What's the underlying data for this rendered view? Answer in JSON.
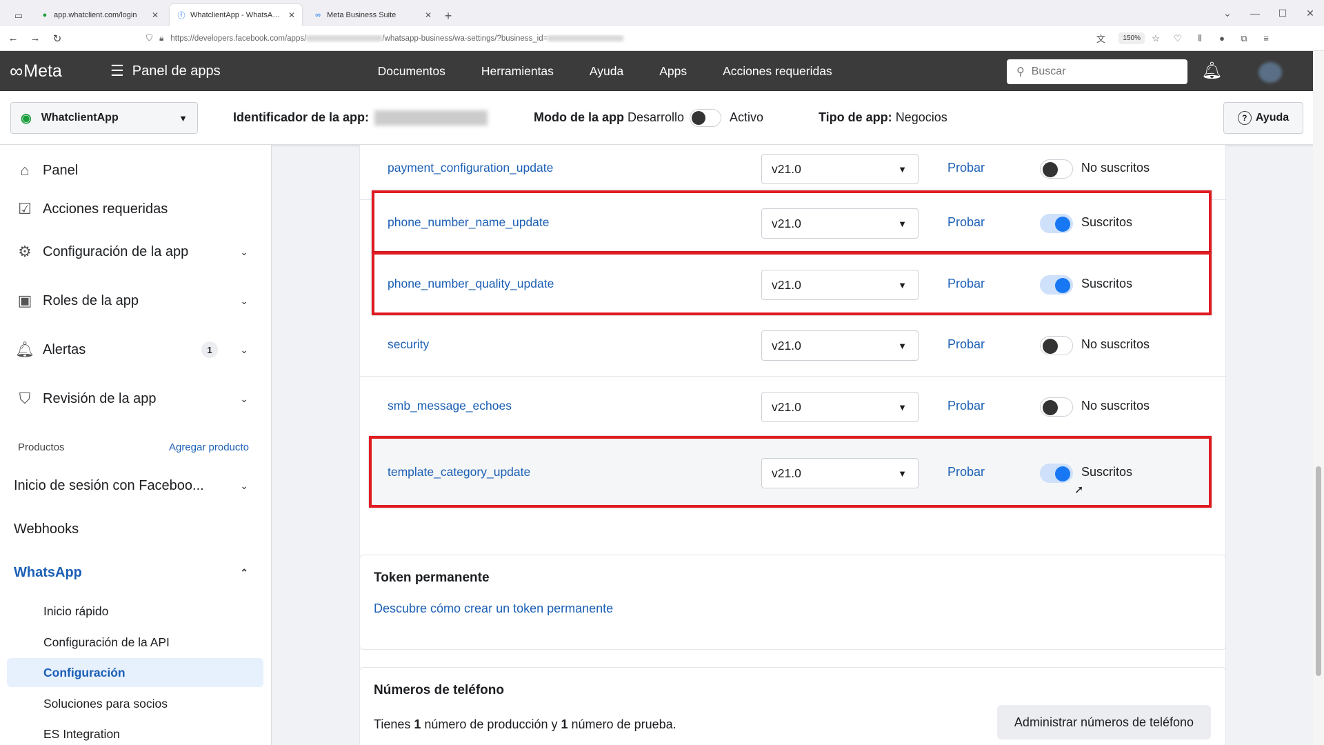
{
  "browser": {
    "tabs": [
      {
        "title": "app.whatclient.com/login",
        "icon": "whatclient-icon"
      },
      {
        "title": "WhatclientApp - WhatsApp - Meta",
        "icon": "facebook-icon"
      },
      {
        "title": "Meta Business Suite",
        "icon": "meta-icon"
      }
    ],
    "url_start": "https://developers.facebook.com/apps/",
    "url_mid": "/whatsapp-business/wa-settings/?business_id=",
    "zoom": "150%"
  },
  "header": {
    "logo": "Meta",
    "panel_title": "Panel de apps",
    "nav": [
      "Documentos",
      "Herramientas",
      "Ayuda",
      "Apps",
      "Acciones requeridas"
    ],
    "search_placeholder": "Buscar"
  },
  "appbar": {
    "app_name": "WhatclientApp",
    "app_id_label": "Identificador de la app:",
    "mode_label": "Modo de la app",
    "mode_dev": "Desarrollo",
    "mode_active": "Activo",
    "type_label": "Tipo de app:",
    "type_value": "Negocios",
    "help": "Ayuda"
  },
  "sidebar": {
    "items": [
      {
        "label": "Panel",
        "icon": "house-icon"
      },
      {
        "label": "Acciones requeridas",
        "icon": "checklist-icon"
      },
      {
        "label": "Configuración de la app",
        "icon": "gear-icon"
      },
      {
        "label": "Roles de la app",
        "icon": "id-badge-icon"
      },
      {
        "label": "Alertas",
        "icon": "bell-icon",
        "badge": "1"
      },
      {
        "label": "Revisión de la app",
        "icon": "shield-check-icon"
      }
    ],
    "products_label": "Productos",
    "add_product": "Agregar producto",
    "fb_login": "Inicio de sesión con Faceboo...",
    "webhooks": "Webhooks",
    "whatsapp": "WhatsApp",
    "whatsapp_sub": [
      "Inicio rápido",
      "Configuración de la API",
      "Configuración",
      "Soluciones para socios",
      "ES Integration"
    ]
  },
  "webhooks": {
    "rows": [
      {
        "field": "payment_configuration_update",
        "version": "v21.0",
        "test": "Probar",
        "status": "No suscritos",
        "subscribed": false,
        "highlighted": false
      },
      {
        "field": "phone_number_name_update",
        "version": "v21.0",
        "test": "Probar",
        "status": "Suscritos",
        "subscribed": true,
        "highlighted": true
      },
      {
        "field": "phone_number_quality_update",
        "version": "v21.0",
        "test": "Probar",
        "status": "Suscritos",
        "subscribed": true,
        "highlighted": true
      },
      {
        "field": "security",
        "version": "v21.0",
        "test": "Probar",
        "status": "No suscritos",
        "subscribed": false,
        "highlighted": false
      },
      {
        "field": "smb_message_echoes",
        "version": "v21.0",
        "test": "Probar",
        "status": "No suscritos",
        "subscribed": false,
        "highlighted": false
      },
      {
        "field": "template_category_update",
        "version": "v21.0",
        "test": "Probar",
        "status": "Suscritos",
        "subscribed": true,
        "highlighted": true
      }
    ]
  },
  "token": {
    "title": "Token permanente",
    "link": "Descubre cómo crear un token permanente"
  },
  "phones": {
    "title": "Números de teléfono",
    "desc_1": "Tienes ",
    "count_prod": "1",
    "desc_2": " número de producción y ",
    "count_test": "1",
    "desc_3": " número de prueba.",
    "manage": "Administrar números de teléfono"
  },
  "colors": {
    "link": "#1b5fb5",
    "highlight": "#e01b22",
    "toggle_on": "#1877f2"
  }
}
